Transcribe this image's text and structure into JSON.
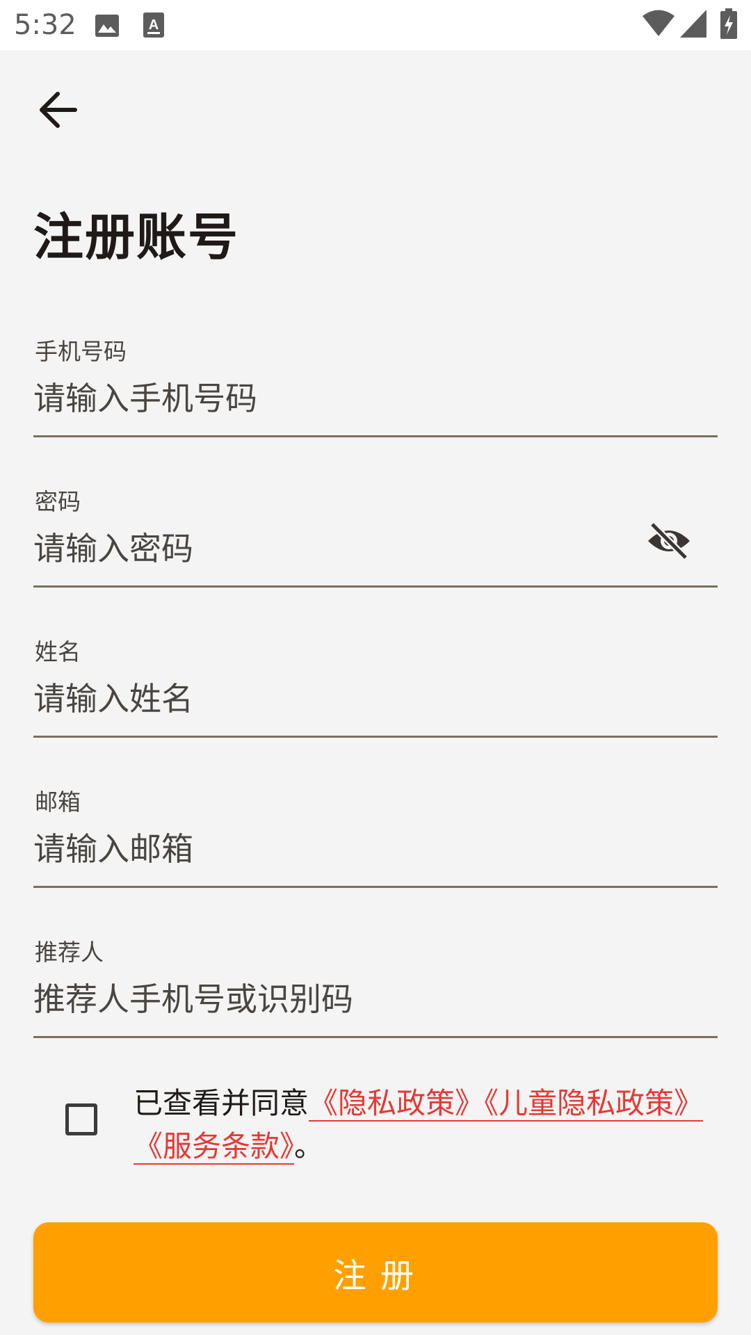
{
  "status_bar": {
    "time": "5:32",
    "icons": [
      "image-icon",
      "a-text-icon",
      "wifi-icon",
      "cellular-signal-icon",
      "battery-charging-icon"
    ]
  },
  "header": {
    "back_icon": "arrow-left-icon",
    "title": "注册账号"
  },
  "form": {
    "phone": {
      "label": "手机号码",
      "value": "",
      "placeholder": "请输入手机号码"
    },
    "password": {
      "label": "密码",
      "value": "",
      "placeholder": "请输入密码",
      "toggle_icon": "eye-off-icon"
    },
    "name": {
      "label": "姓名",
      "value": "",
      "placeholder": "请输入姓名"
    },
    "email": {
      "label": "邮箱",
      "value": "",
      "placeholder": "请输入邮箱"
    },
    "referrer": {
      "label": "推荐人",
      "value": "",
      "placeholder": "推荐人手机号或识别码"
    }
  },
  "agreement": {
    "checked": false,
    "prefix": "已查看并同意",
    "privacy_link": "《隐私政策》",
    "child_privacy_link": "《儿童隐私政策》",
    "terms_link": "《服务条款》",
    "suffix": "。"
  },
  "submit": {
    "label": "注册"
  },
  "colors": {
    "accent": "#ffa000",
    "link": "#e53935",
    "background": "#f4f4f4",
    "underline": "#7a6e62"
  }
}
